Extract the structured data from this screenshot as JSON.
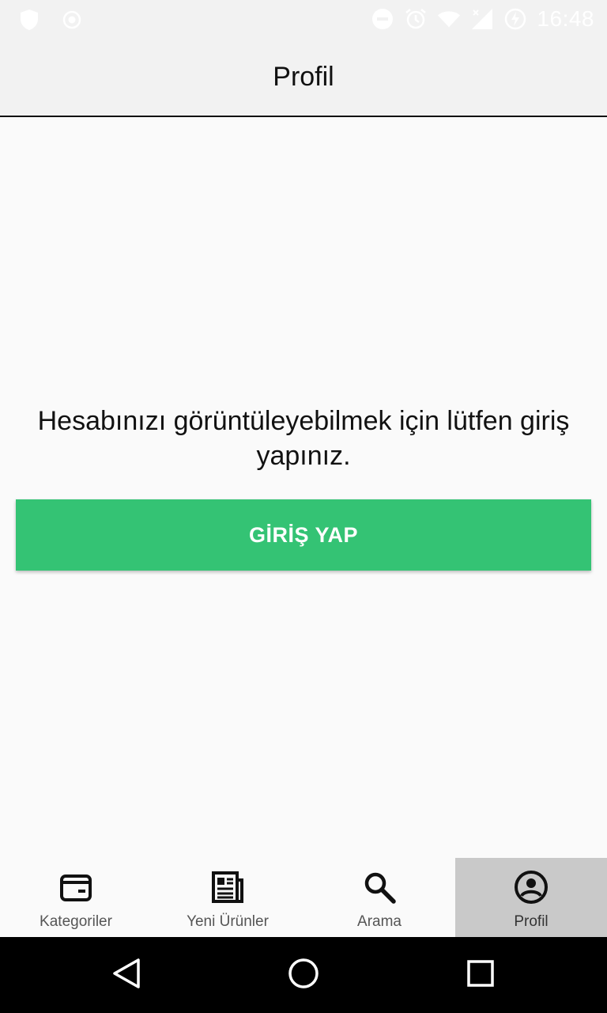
{
  "status_bar": {
    "time": "16:48",
    "icons": [
      "shield-icon",
      "record-icon",
      "do-not-disturb-icon",
      "alarm-icon",
      "wifi-icon",
      "signal-icon",
      "battery-charging-icon"
    ]
  },
  "app_bar": {
    "title": "Profil"
  },
  "main": {
    "message": "Hesabınızı görüntüleyebilmek için lütfen giriş yapınız.",
    "login_button": "GİRİŞ YAP"
  },
  "tabs": [
    {
      "label": "Kategoriler",
      "icon": "wallet-icon",
      "active": false
    },
    {
      "label": "Yeni Ürünler",
      "icon": "newspaper-icon",
      "active": false
    },
    {
      "label": "Arama",
      "icon": "search-icon",
      "active": false
    },
    {
      "label": "Profil",
      "icon": "account-circle-icon",
      "active": true
    }
  ],
  "colors": {
    "primary_button": "#34c374",
    "active_tab": "#c9c9c9",
    "app_bar": "#f2f2f2"
  }
}
